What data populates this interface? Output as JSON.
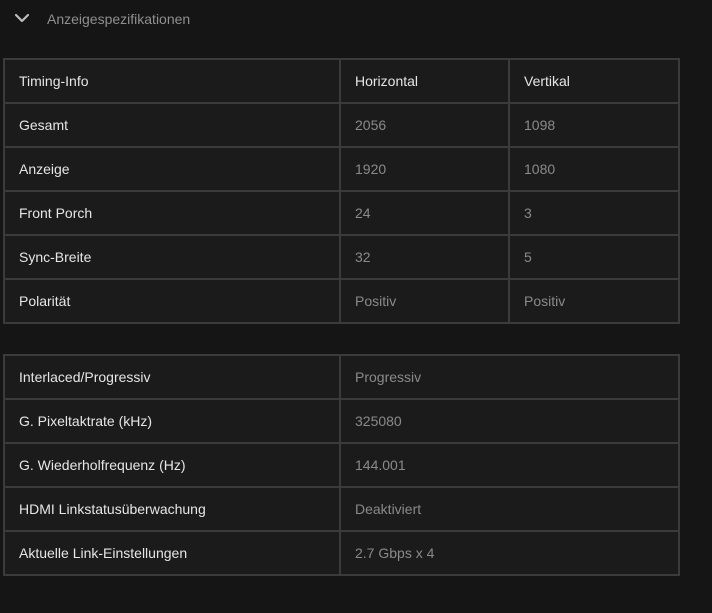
{
  "section": {
    "title": "Anzeigespezifikationen",
    "toggle_icon": "chevron-down-icon"
  },
  "timing_table": {
    "headers": [
      "Timing-Info",
      "Horizontal",
      "Vertikal"
    ],
    "rows": [
      {
        "label": "Gesamt",
        "horizontal": "2056",
        "vertical": "1098"
      },
      {
        "label": "Anzeige",
        "horizontal": "1920",
        "vertical": "1080"
      },
      {
        "label": "Front Porch",
        "horizontal": "24",
        "vertical": "3"
      },
      {
        "label": "Sync-Breite",
        "horizontal": "32",
        "vertical": "5"
      },
      {
        "label": "Polarität",
        "horizontal": "Positiv",
        "vertical": "Positiv"
      }
    ]
  },
  "link_table": {
    "rows": [
      {
        "label": "Interlaced/Progressiv",
        "value": "Progressiv"
      },
      {
        "label": "G. Pixeltaktrate (kHz)",
        "value": "325080"
      },
      {
        "label": "G. Wiederholfrequenz (Hz)",
        "value": "144.001"
      },
      {
        "label": "HDMI Linkstatusüberwachung",
        "value": "Deaktiviert"
      },
      {
        "label": "Aktuelle Link-Einstellungen",
        "value": "2.7 Gbps x 4"
      }
    ]
  }
}
